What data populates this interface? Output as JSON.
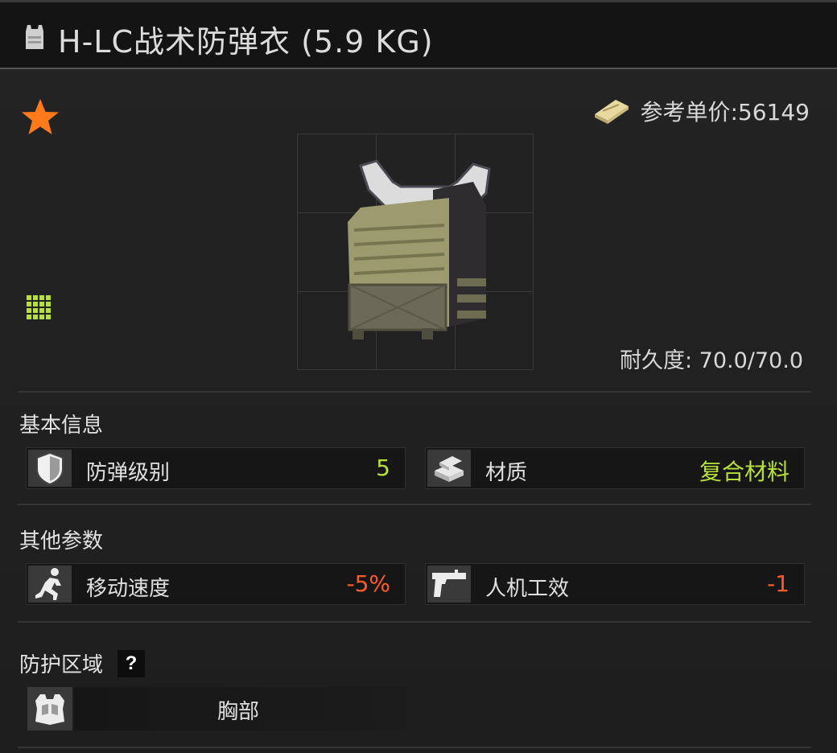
{
  "header": {
    "title": "H-LC战术防弹衣 (5.9 KG)",
    "icon": "vest-icon"
  },
  "item": {
    "favorite_icon": "star-icon",
    "grid_size_icon": "grid-icon",
    "price_icon": "money-icon",
    "price_label": "参考单价:56149",
    "durability_label": "耐久度: 70.0/70.0",
    "image": "plate-carrier-vest"
  },
  "basic_info": {
    "title": "基本信息",
    "stats": [
      {
        "icon": "shield-icon",
        "label": "防弹级别",
        "value": "5",
        "color": "#b8e03c"
      },
      {
        "icon": "material-icon",
        "label": "材质",
        "value": "复合材料",
        "color": "#b8e03c"
      }
    ]
  },
  "other_params": {
    "title": "其他参数",
    "stats": [
      {
        "icon": "running-icon",
        "label": "移动速度",
        "value": "-5%",
        "color": "#ff5a2a"
      },
      {
        "icon": "pistol-icon",
        "label": "人机工效",
        "value": "-1",
        "color": "#ff5a2a"
      }
    ]
  },
  "protection": {
    "title": "防护区域",
    "help_label": "?",
    "zones": [
      {
        "icon": "chest-armor-icon",
        "label": "胸部"
      }
    ]
  },
  "colors": {
    "accent_orange": "#ff7a1a",
    "positive_green": "#b8e03c",
    "negative_red": "#ff5a2a"
  }
}
